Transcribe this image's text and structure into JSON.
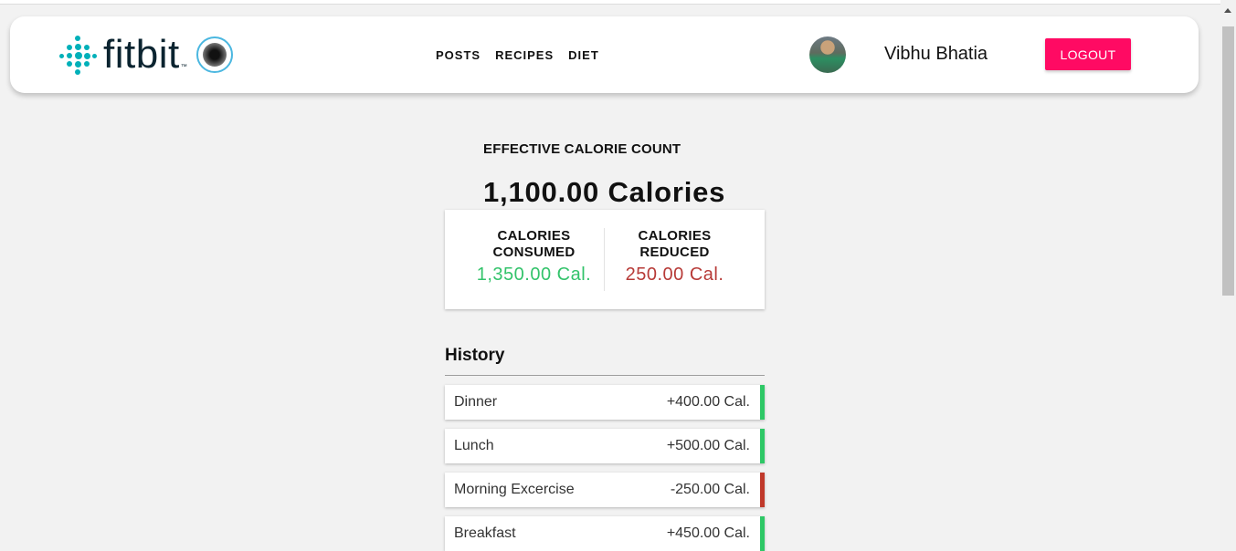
{
  "header": {
    "logo_text": "fitbit",
    "logo_tm": "™",
    "nav": [
      "POSTS",
      "RECIPES",
      "DIET"
    ],
    "user_name": "Vibhu Bhatia",
    "logout_label": "LOGOUT",
    "logout_color": "#ff0a63"
  },
  "summary": {
    "effective_label": "EFFECTIVE CALORIE COUNT",
    "effective_value": "1,100.00 Calories",
    "consumed_label": "CALORIES CONSUMED",
    "consumed_value": "1,350.00 Cal.",
    "reduced_label": "CALORIES REDUCED",
    "reduced_value": "250.00 Cal.",
    "consumed_color": "#33c36b",
    "reduced_color": "#b73a37"
  },
  "history": {
    "title": "History",
    "items": [
      {
        "name": "Dinner",
        "value": "+400.00 Cal.",
        "type": "gain",
        "color": "#2ec866"
      },
      {
        "name": "Lunch",
        "value": "+500.00 Cal.",
        "type": "gain",
        "color": "#2ec866"
      },
      {
        "name": "Morning Excercise",
        "value": "-250.00 Cal.",
        "type": "loss",
        "color": "#c0392b"
      },
      {
        "name": "Breakfast",
        "value": "+450.00 Cal.",
        "type": "gain",
        "color": "#2ec866"
      }
    ]
  }
}
